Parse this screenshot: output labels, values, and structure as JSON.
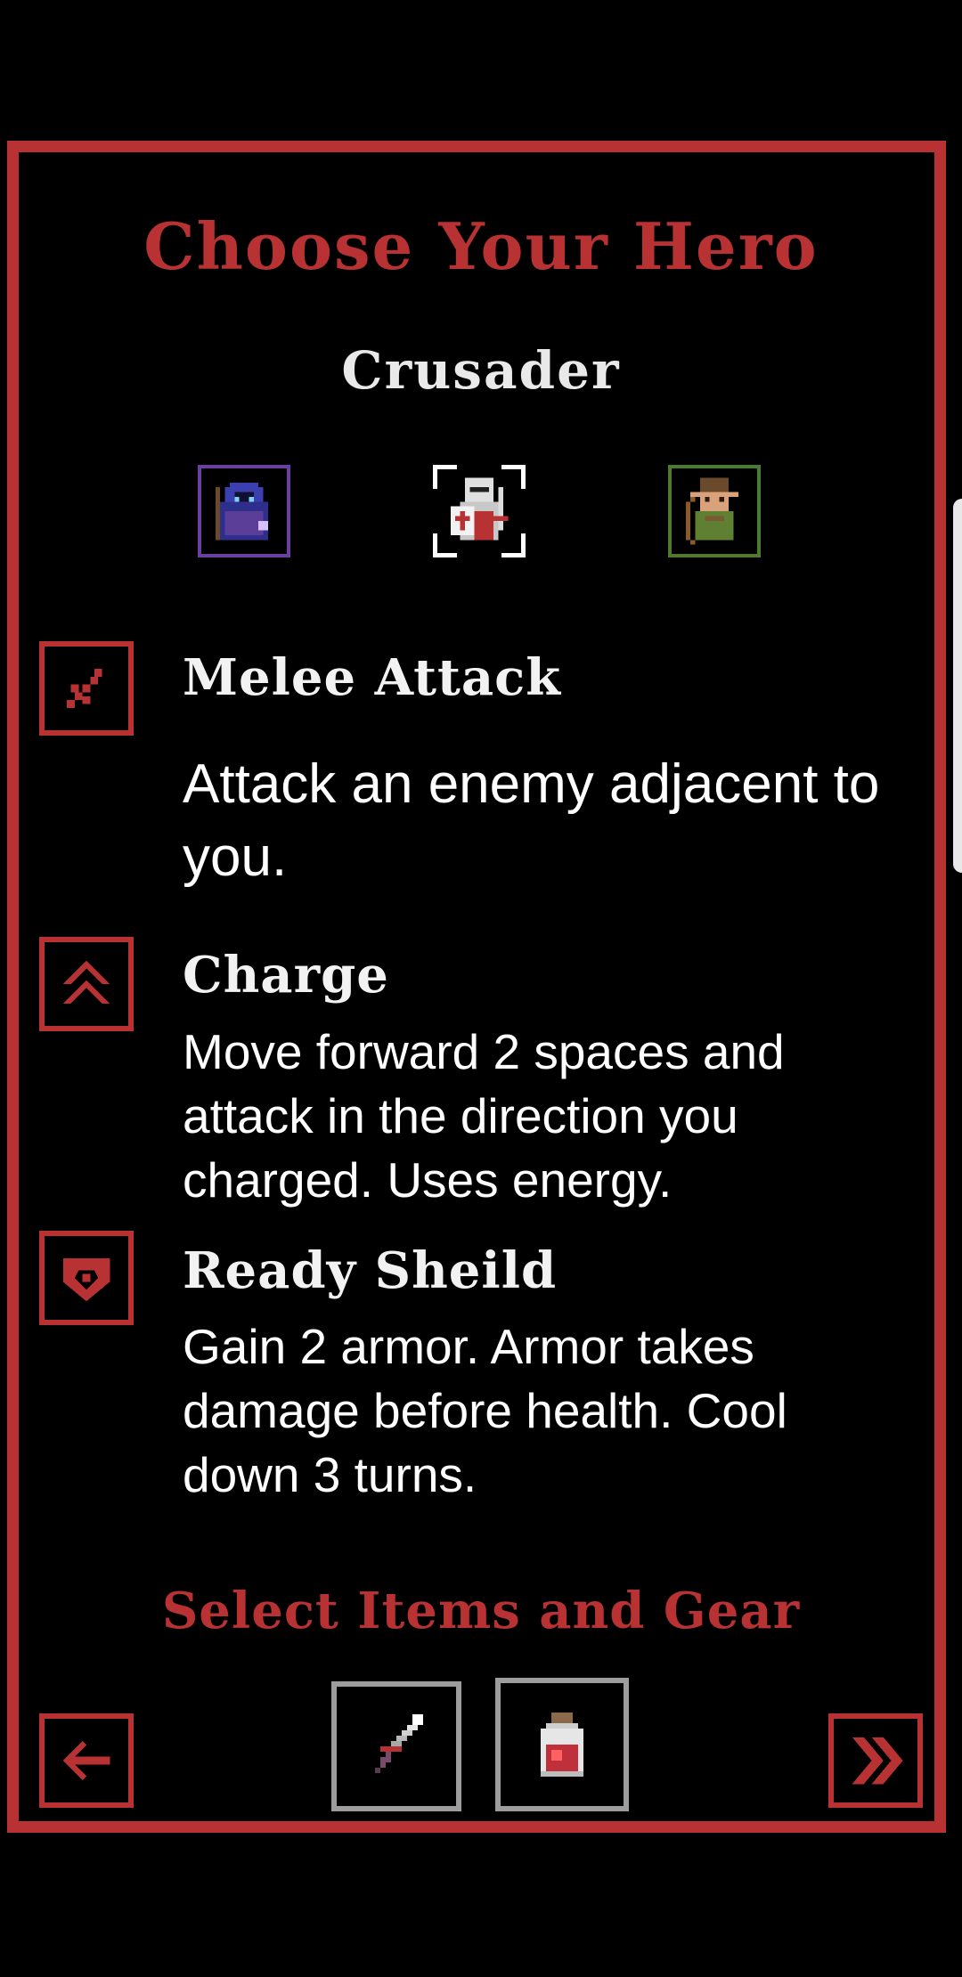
{
  "screen": {
    "title": "Choose Your Hero",
    "selected_hero": "Crusader",
    "heroes": [
      {
        "id": "mage",
        "icon": "hooded-mage-icon",
        "frame_color": "#6a3fa0",
        "selected": false
      },
      {
        "id": "crusader",
        "icon": "crusader-knight-icon",
        "frame_color": "#ffffff",
        "selected": true
      },
      {
        "id": "ranger",
        "icon": "elf-ranger-icon",
        "frame_color": "#4c7a32",
        "selected": false
      }
    ],
    "abilities": [
      {
        "icon": "crossed-sword-icon",
        "name": "Melee Attack",
        "description": "Attack an enemy adjacent to you."
      },
      {
        "icon": "double-chevron-up-icon",
        "name": "Charge",
        "description": "Move forward 2 spaces and attack in the direction you charged. Uses energy."
      },
      {
        "icon": "shield-icon",
        "name": "Ready Sheild",
        "description": "Gain 2 armor. Armor takes damage before health. Cool down 3 turns."
      }
    ],
    "items_section_title": "Select Items and Gear",
    "items": [
      {
        "icon": "sword-item-icon"
      },
      {
        "icon": "health-potion-icon"
      }
    ],
    "nav": {
      "back_icon": "arrow-left-icon",
      "next_icon": "double-chevron-right-icon"
    },
    "colors": {
      "accent": "#b83233",
      "background": "#000000",
      "text": "#ffffff",
      "item_frame": "#9d9d9d"
    }
  }
}
